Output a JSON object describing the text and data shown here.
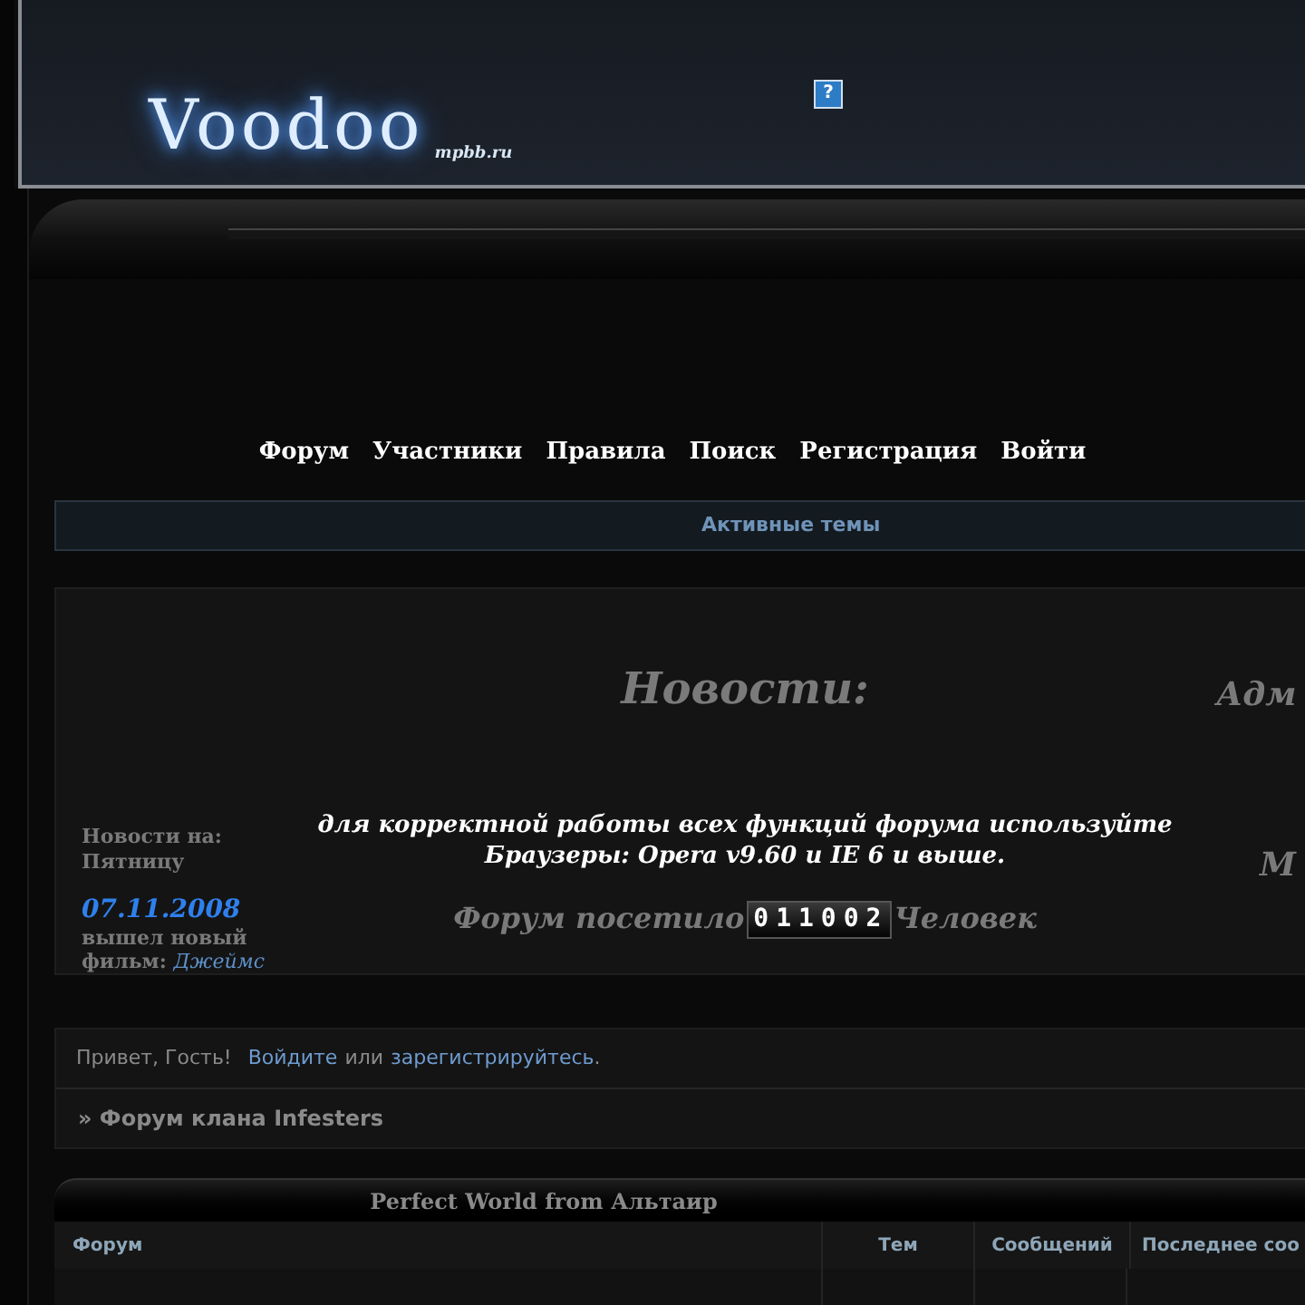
{
  "header": {
    "logo": "Voodoo",
    "site": "mpbb.ru",
    "help_icon": "?"
  },
  "nav": [
    {
      "label": "Форум"
    },
    {
      "label": "Участники"
    },
    {
      "label": "Правила"
    },
    {
      "label": "Поиск"
    },
    {
      "label": "Регистрация"
    },
    {
      "label": "Войти"
    }
  ],
  "active_topics": "Активные темы",
  "news": {
    "left": {
      "label": "Новости на:",
      "day": "Пятницу",
      "date": "07.11.2008",
      "text": "вышел новый",
      "text2": "фильм:",
      "link": "Джеймс"
    },
    "title": "Новости:",
    "notice_line1": "для корректной работы всех функций форума используйте",
    "notice_line2": "Браузеры: Opera v9.60 и IE 6 и выше.",
    "counter_before": "Форум посетило",
    "counter": "011002",
    "counter_after": "Человек",
    "right_1": "Адм",
    "right_2": "М"
  },
  "greeting": {
    "text": "Привет, Гость!",
    "login": "Войдите",
    "or": "или",
    "register": "зарегистрируйтесь",
    "dot": "."
  },
  "breadcrumb": "» Форум клана Infesters",
  "category": {
    "title": "Perfect World from Альтаир",
    "columns": [
      "Форум",
      "Тем",
      "Сообщений",
      "Последнее соо"
    ]
  }
}
